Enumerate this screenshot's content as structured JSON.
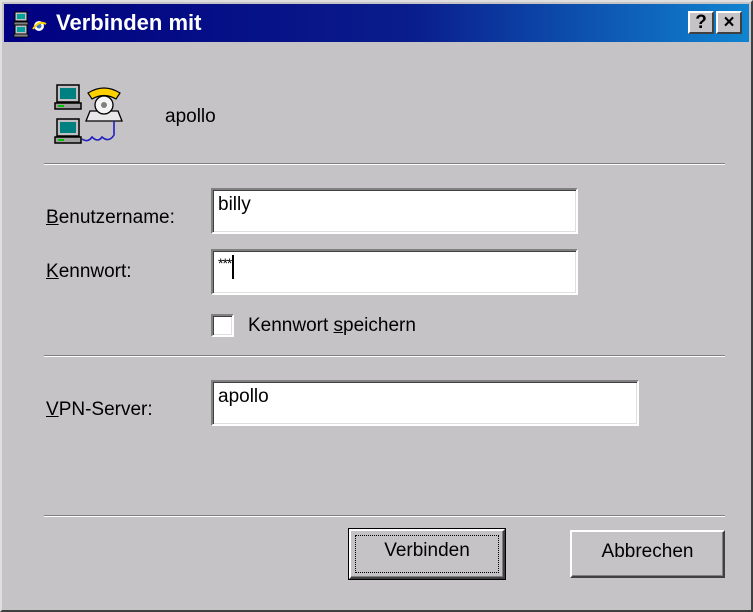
{
  "window": {
    "title": "Verbinden mit",
    "help_label": "?",
    "close_label": "×"
  },
  "connection": {
    "name": "apollo"
  },
  "form": {
    "username_label_prefix": "",
    "username_label_underline": "B",
    "username_label_rest": "enutzername:",
    "username_value": "billy",
    "password_label_underline": "K",
    "password_label_rest": "ennwort:",
    "password_mask": "***",
    "save_password_label_start": "Kennwort ",
    "save_password_label_underline": "s",
    "save_password_label_rest": "peichern",
    "save_password_checked": false,
    "vpn_label_underline": "V",
    "vpn_label_rest": "PN-Server:",
    "vpn_value": "apollo"
  },
  "buttons": {
    "connect_label": "Verbinden",
    "cancel_label": "Abbrechen"
  },
  "colors": {
    "title_start": "#000080",
    "title_end": "#1084d0",
    "face": "#c6c3c6"
  }
}
